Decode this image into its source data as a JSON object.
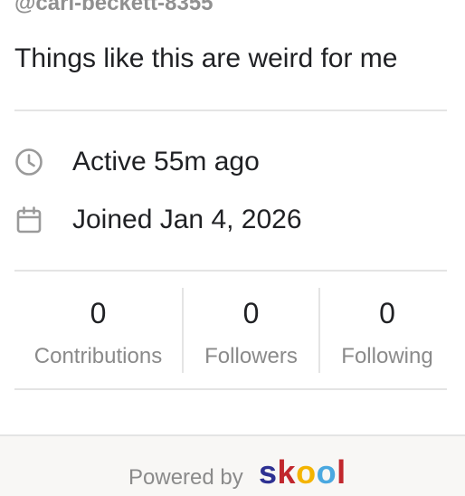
{
  "profile": {
    "handle": "@carl-beckett-8355",
    "bio": "Things like this are weird for me",
    "active": "Active 55m ago",
    "joined": "Joined Jan 4, 2026"
  },
  "icons": {
    "active": "clock-icon",
    "joined": "calendar-icon"
  },
  "stats": [
    {
      "value": "0",
      "label": "Contributions"
    },
    {
      "value": "0",
      "label": "Followers"
    },
    {
      "value": "0",
      "label": "Following"
    }
  ],
  "footer": {
    "powered_by": "Powered by",
    "logo": {
      "letters": [
        "s",
        "k",
        "o",
        "o",
        "l"
      ],
      "colors": [
        "#2e3192",
        "#c1272d",
        "#f4b400",
        "#4aa8e0",
        "#c1272d"
      ]
    }
  }
}
